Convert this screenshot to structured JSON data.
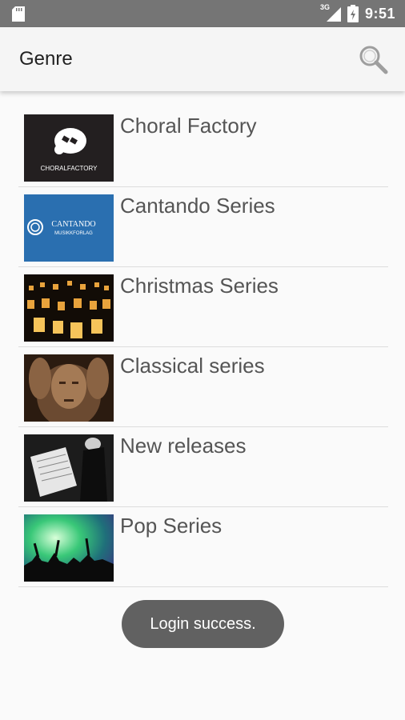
{
  "status_bar": {
    "network_label": "3G",
    "time": "9:51",
    "icons": [
      "sd-card-icon",
      "signal-icon",
      "battery-icon"
    ]
  },
  "toolbar": {
    "title": "Genre",
    "search_icon": "search-icon"
  },
  "genres": [
    {
      "label": "Choral Factory",
      "thumb_text": "CHORALFACTORY"
    },
    {
      "label": "Cantando Series",
      "thumb_text": "CANTANDO",
      "thumb_subtext": "MUSIKKFORLAG"
    },
    {
      "label": "Christmas Series"
    },
    {
      "label": "Classical series"
    },
    {
      "label": "New releases"
    },
    {
      "label": "Pop Series"
    }
  ],
  "toast": {
    "message": "Login success."
  },
  "colors": {
    "status_bar": "#757575",
    "toolbar": "#f5f5f5",
    "background": "#fafafa",
    "toast": "#616161",
    "cantando_blue": "#2a6fb0"
  }
}
